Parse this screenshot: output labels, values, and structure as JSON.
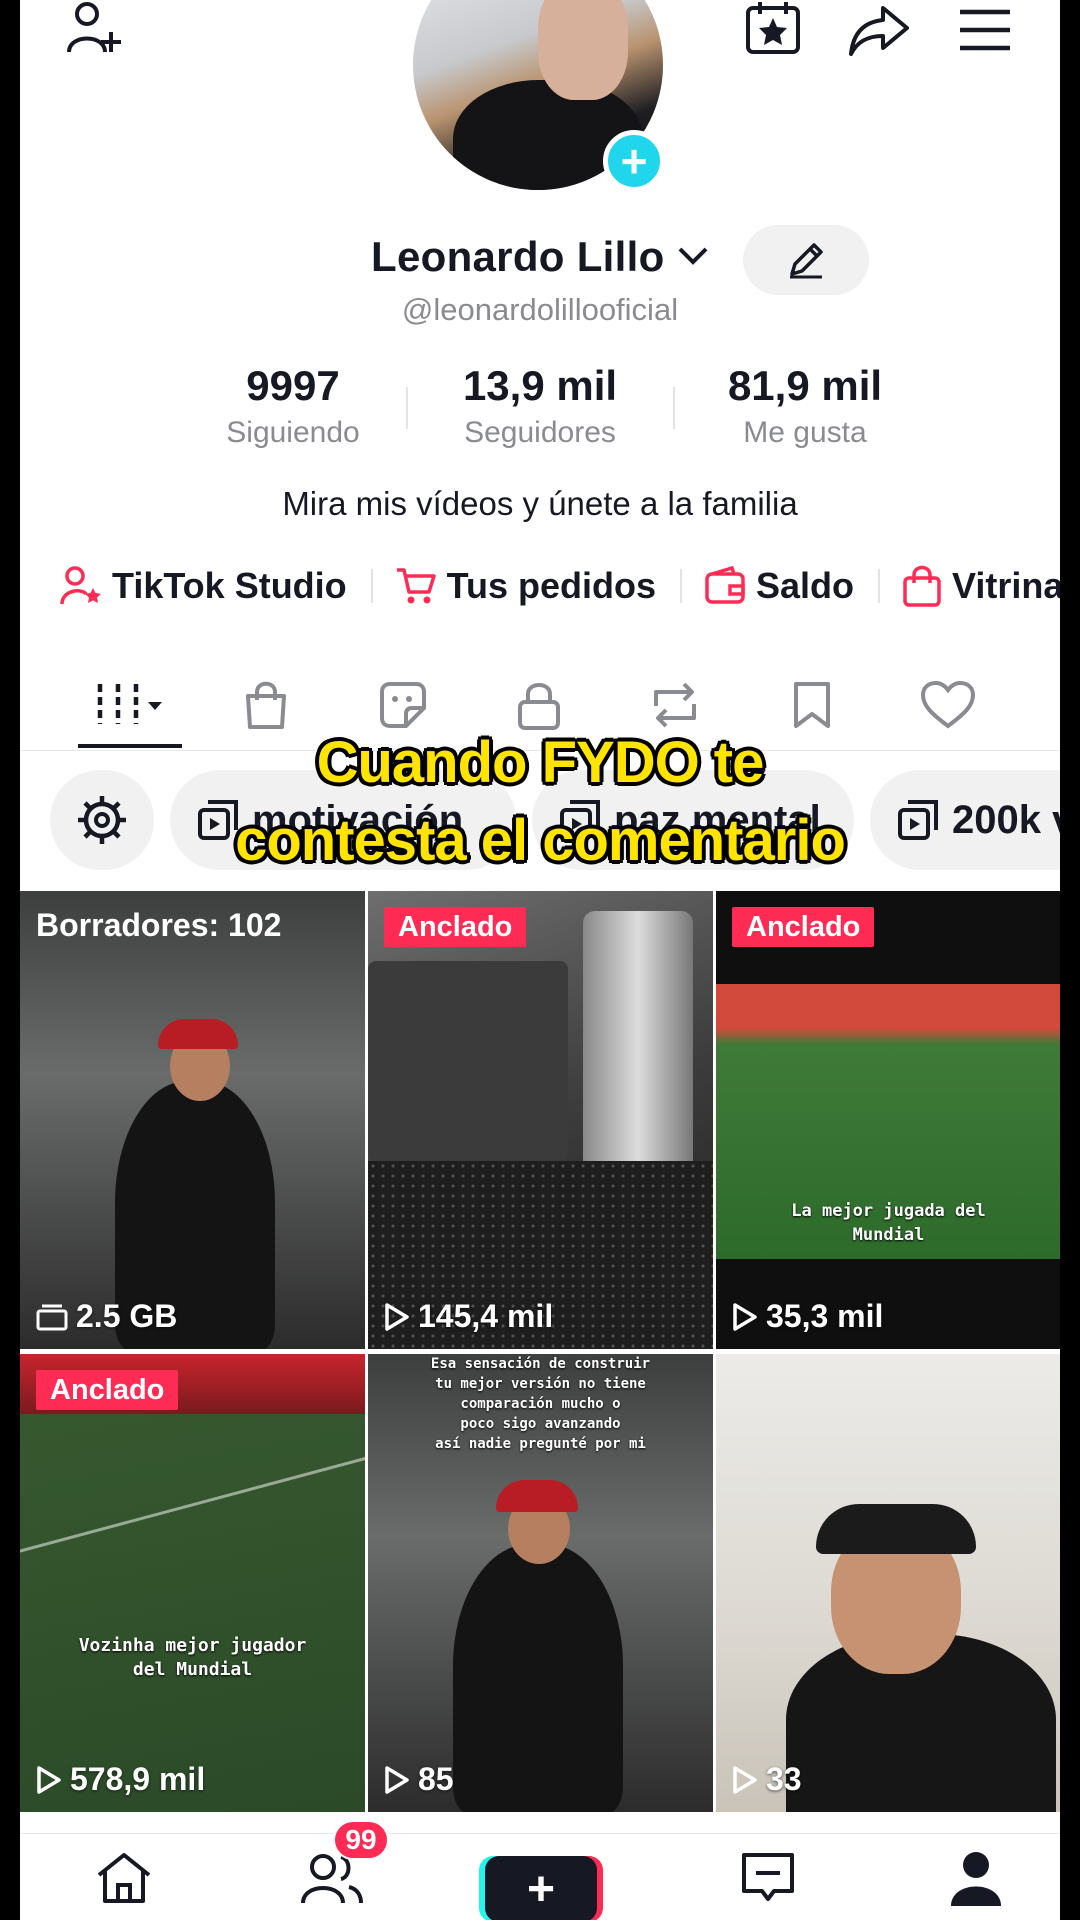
{
  "profile": {
    "name": "Leonardo Lillo",
    "username": "@leonardolillooficial",
    "bio": "Mira mis vídeos y únete a la familia"
  },
  "stats": [
    {
      "value": "9997",
      "label": "Siguiendo"
    },
    {
      "value": "13,9 mil",
      "label": "Seguidores"
    },
    {
      "value": "81,9 mil",
      "label": "Me gusta"
    }
  ],
  "links": [
    {
      "label": "TikTok Studio",
      "icon": "person-star-icon"
    },
    {
      "label": "Tus pedidos",
      "icon": "cart-icon"
    },
    {
      "label": "Saldo",
      "icon": "wallet-icon"
    },
    {
      "label": "Vitrina",
      "icon": "shopping-bag-icon"
    }
  ],
  "tabs": [
    "videos-grid",
    "shop",
    "stickers",
    "private",
    "reposts",
    "favorites",
    "liked"
  ],
  "playlists": [
    {
      "label": "motivación"
    },
    {
      "label": "paz mental"
    },
    {
      "label": "200k v"
    }
  ],
  "caption": {
    "line1": "Cuando FYDO te",
    "line2": "contesta el comentario"
  },
  "videos": [
    {
      "type": "drafts",
      "label": "Borradores: 102",
      "size": "2.5 GB"
    },
    {
      "badge": "Anclado",
      "views": "145,4 mil"
    },
    {
      "badge": "Anclado",
      "views": "35,3 mil",
      "overlay": "La mejor jugada del\nMundial"
    },
    {
      "badge": "Anclado",
      "views": "578,9 mil",
      "overlay": "Vozinha mejor jugador\ndel Mundial"
    },
    {
      "views": "85",
      "overlay": "Esa sensación de construir\ntu mejor versión no tiene\ncomparación mucho o\npoco sigo avanzando\nasí nadie pregunté por mi"
    },
    {
      "views": "33"
    }
  ],
  "nav": {
    "inbox_badge": "99"
  },
  "colors": {
    "accent": "#fe2c55",
    "cyan": "#20d5ec",
    "caption": "#ffe400",
    "text": "#161823",
    "muted": "#8a8b91"
  }
}
